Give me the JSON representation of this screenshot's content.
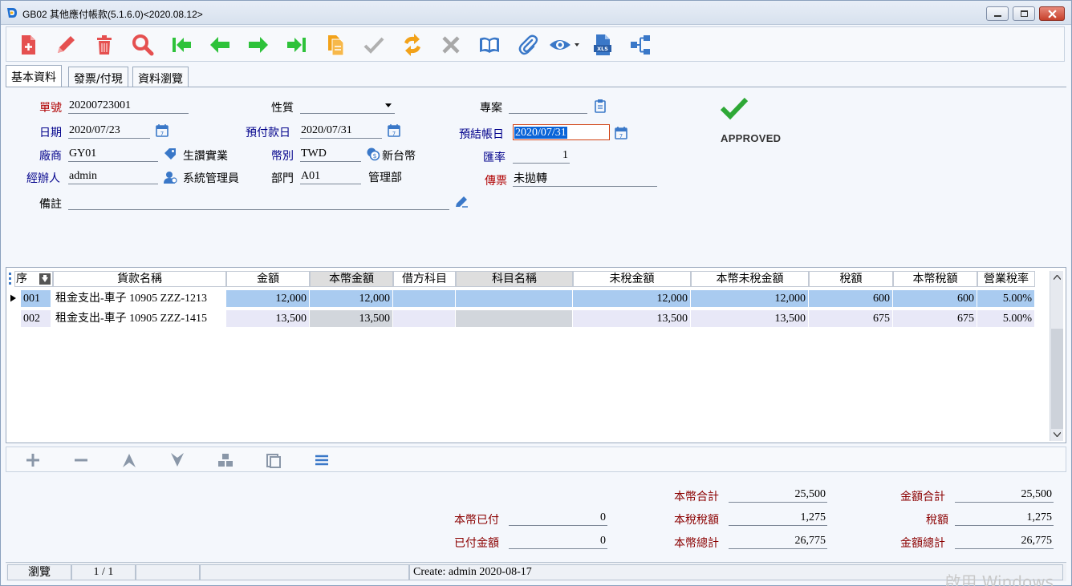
{
  "window": {
    "title": "GB02 其他應付帳款(5.1.6.0)<2020.08.12>"
  },
  "tabs": [
    "基本資料",
    "發票/付現",
    "資料瀏覽"
  ],
  "form": {
    "doc_no_label": "單號",
    "doc_no": "20200723001",
    "nature_label": "性質",
    "nature": "",
    "project_label": "專案",
    "project": "",
    "date_label": "日期",
    "date": "2020/07/23",
    "prepay_date_label": "預付款日",
    "prepay_date": "2020/07/31",
    "settle_date_label": "預結帳日",
    "settle_date": "2020/07/31",
    "vendor_label": "廠商",
    "vendor": "GY01",
    "vendor_name": "生讚實業",
    "currency_label": "幣別",
    "currency": "TWD",
    "currency_name": "新台幣",
    "rate_label": "匯率",
    "rate": "1",
    "handler_label": "經辦人",
    "handler": "admin",
    "handler_name": "系統管理員",
    "dept_label": "部門",
    "dept": "A01",
    "dept_name": "管理部",
    "voucher_label": "傳票",
    "voucher": "未拋轉",
    "remark_label": "備註",
    "remark": "",
    "status": "APPROVED"
  },
  "grid": {
    "headers": [
      "序",
      "貨款名稱",
      "金額",
      "本幣金額",
      "借方科目",
      "科目名稱",
      "未稅金額",
      "本幣未稅金額",
      "稅額",
      "本幣稅額",
      "營業稅率"
    ],
    "rows": [
      {
        "seq": "001",
        "name": "租金支出-車子 10905 ZZZ-1213",
        "amount": "12,000",
        "local_amount": "12,000",
        "debit": "",
        "account": "",
        "pretax": "12,000",
        "local_pretax": "12,000",
        "tax": "600",
        "local_tax": "600",
        "rate": "5.00%"
      },
      {
        "seq": "002",
        "name": "租金支出-車子 10905 ZZZ-1415",
        "amount": "13,500",
        "local_amount": "13,500",
        "debit": "",
        "account": "",
        "pretax": "13,500",
        "local_pretax": "13,500",
        "tax": "675",
        "local_tax": "675",
        "rate": "5.00%"
      }
    ]
  },
  "totals": {
    "local_paid_label": "本幣已付",
    "local_paid": "0",
    "paid_label": "已付金額",
    "paid": "0",
    "local_sum_label": "本幣合計",
    "local_sum": "25,500",
    "local_tax_label": "本稅稅額",
    "local_tax": "1,275",
    "local_total_label": "本幣總計",
    "local_total": "26,775",
    "amount_sum_label": "金額合計",
    "amount_sum": "25,500",
    "tax_label": "稅額",
    "tax": "1,275",
    "amount_total_label": "金額總計",
    "amount_total": "26,775"
  },
  "status_bar": {
    "mode": "瀏覽",
    "page": "1 / 1",
    "created": "Create: admin 2020-08-17"
  },
  "watermark": "啟用 Windows",
  "colors": {
    "red_icon": "#e04a4a",
    "green_icon": "#2ec23a",
    "orange_icon": "#f2a21a",
    "blue_icon": "#3a78c8",
    "selected_row": "#a9cbf0"
  }
}
